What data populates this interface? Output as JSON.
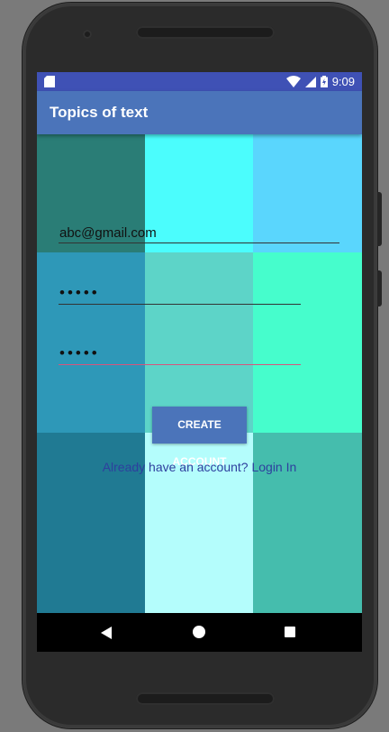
{
  "status_bar": {
    "time": "9:09",
    "icons": [
      "sd-card-icon",
      "wifi-icon",
      "signal-icon",
      "battery-icon"
    ]
  },
  "app_bar": {
    "title": "Topics of text"
  },
  "form": {
    "email_value": "abc@gmail.com",
    "password_value": "•••••",
    "confirm_password_value": "•••••",
    "create_button_label": "CREATE ACCOUNT",
    "login_link": "Already have an account? Login In"
  },
  "navigation": {
    "buttons": [
      "back-icon",
      "home-icon",
      "recents-icon"
    ]
  },
  "colors": {
    "status_bar": "#3f51b5",
    "app_bar": "#4b74ba",
    "grid": [
      "#2a7d76",
      "#4bfdfd",
      "#5ad6fd",
      "#2e98b8",
      "#5dd4c8",
      "#46fdcc",
      "#207a93",
      "#b4fdfc",
      "#45bdad"
    ],
    "focused_underline": "#d9547c"
  }
}
